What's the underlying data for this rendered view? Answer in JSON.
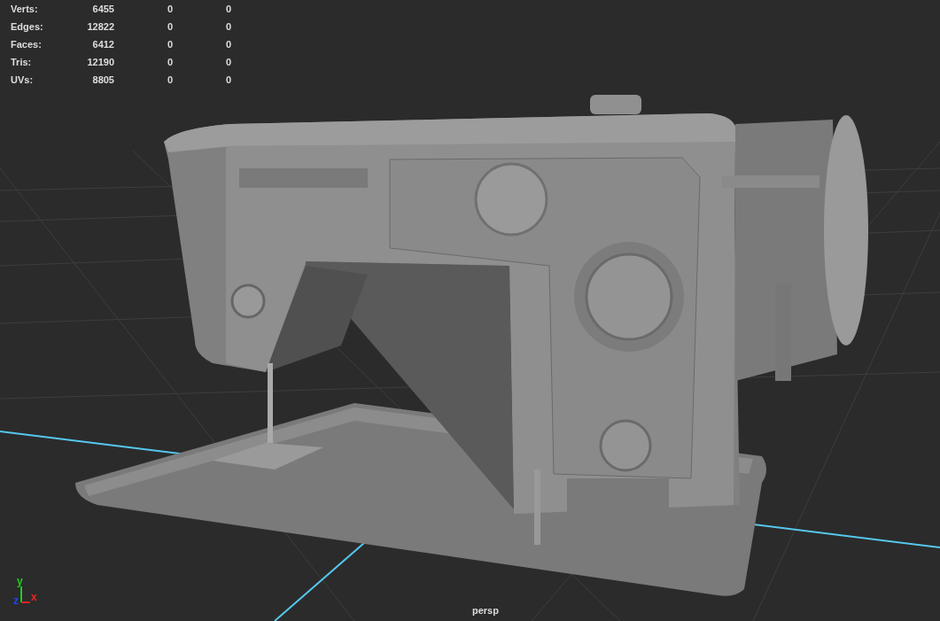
{
  "stats": [
    {
      "label": "Verts:",
      "values": [
        "6455",
        "0",
        "0"
      ]
    },
    {
      "label": "Edges:",
      "values": [
        "12822",
        "0",
        "0"
      ]
    },
    {
      "label": "Faces:",
      "values": [
        "6412",
        "0",
        "0"
      ]
    },
    {
      "label": "Tris:",
      "values": [
        "12190",
        "0",
        "0"
      ]
    },
    {
      "label": "UVs:",
      "values": [
        "8805",
        "0",
        "0"
      ]
    }
  ],
  "axis_gizmo": {
    "y": "y",
    "x": "x",
    "z": "z"
  },
  "camera": "persp"
}
